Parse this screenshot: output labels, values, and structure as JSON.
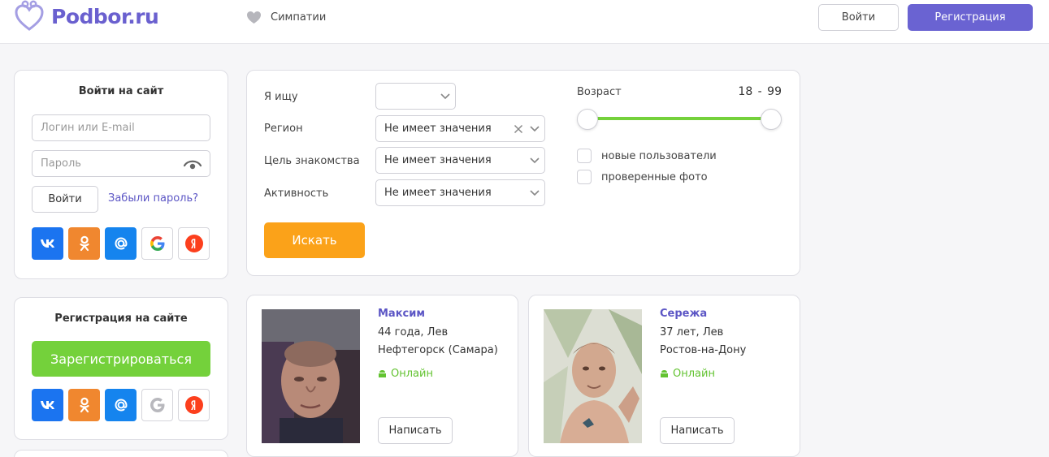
{
  "header": {
    "logo_text": "Podbor.ru",
    "likes_label": "Симпатии",
    "login_button": "Войти",
    "register_button": "Регистрация"
  },
  "login_card": {
    "title": "Войти на сайт",
    "login_placeholder": "Логин или E-mail",
    "password_placeholder": "Пароль",
    "submit_label": "Войти",
    "forgot_label": "Забыли пароль?"
  },
  "register_card": {
    "title": "Регистрация на сайте",
    "button_label": "Зарегистрироваться"
  },
  "social_icons": [
    "vk-icon",
    "odnoklassniki-icon",
    "mail-ru-icon",
    "google-icon",
    "yandex-icon"
  ],
  "search": {
    "looking_for_label": "Я ищу",
    "looking_for_value": "",
    "region_label": "Регион",
    "region_value": "Не имеет значения",
    "goal_label": "Цель знакомства",
    "goal_value": "Не имеет значения",
    "activity_label": "Активность",
    "activity_value": "Не имеет значения",
    "search_button": "Искать",
    "age_label": "Возраст",
    "age_min": 18,
    "age_max": 99,
    "age_range_text": "18 - 99",
    "new_users_label": "новые пользователи",
    "verified_photo_label": "проверенные фото"
  },
  "profiles": [
    {
      "name": "Максим",
      "age_sign": "44 года, Лев",
      "city": "Нефтегорск (Самара)",
      "status": "Онлайн",
      "write_label": "Написать"
    },
    {
      "name": "Сережа",
      "age_sign": "37 лет, Лев",
      "city": "Ростов-на-Дону",
      "status": "Онлайн",
      "write_label": "Написать"
    }
  ],
  "colors": {
    "brand": "#6a63d2",
    "green": "#74d13b",
    "orange": "#fba219",
    "online": "#63c331"
  }
}
